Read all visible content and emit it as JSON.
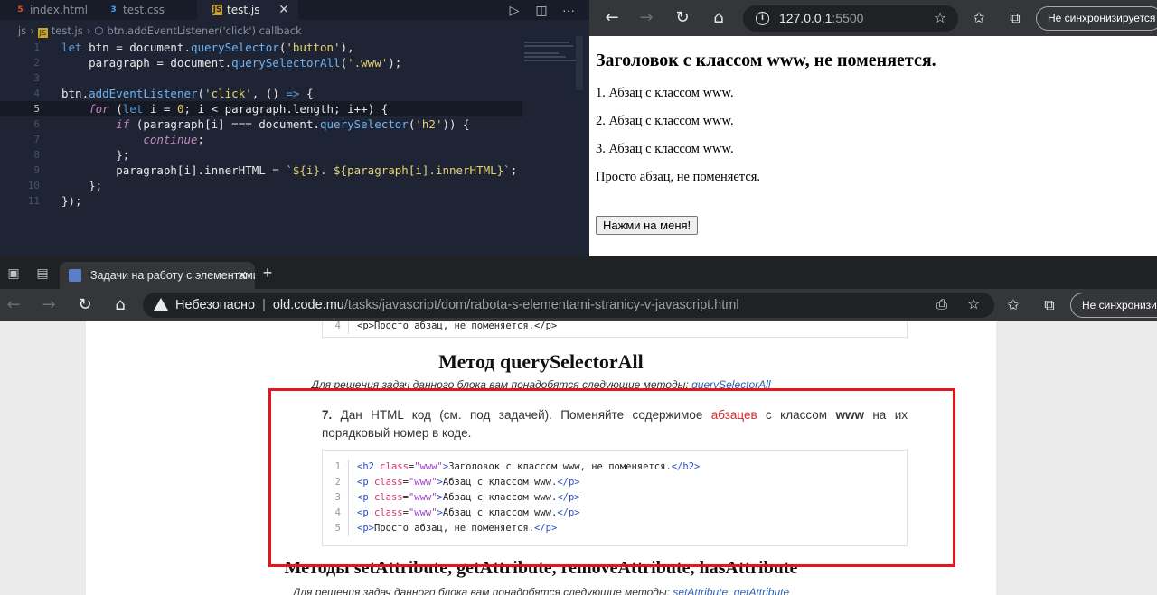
{
  "vscode": {
    "tabs": [
      {
        "name": "index.html",
        "icon": "html-file-icon",
        "color": "#e44d26"
      },
      {
        "name": "test.css",
        "icon": "css-file-icon",
        "color": "#42a5f5"
      },
      {
        "name": "test.js",
        "icon": "js-file-icon",
        "color": "#c9a227",
        "active": true
      }
    ],
    "breadcrumb": [
      "js",
      "test.js",
      "btn.addEventListener('click') callback"
    ],
    "line_numbers": [
      "1",
      "2",
      "3",
      "4",
      "5",
      "6",
      "7",
      "8",
      "9",
      "10",
      "11"
    ],
    "current_line": 5
  },
  "browser1": {
    "url_host": "127.0.0.1",
    "url_port": ":5500",
    "sync_label": "Не синхронизируется",
    "heading": "Заголовок с классом www, не поменяется.",
    "paragraphs": [
      "1. Абзац с классом www.",
      "2. Абзац с классом www.",
      "3. Абзац с классом www.",
      "Просто абзац, не поменяется."
    ],
    "button_label": "Нажми на меня!"
  },
  "browser2": {
    "tab_title": "Задачи на работу с элементами",
    "insecure_label": "Небезопасно",
    "url_host": "old.code.mu",
    "url_path": "/tasks/javascript/dom/rabota-s-elementami-stranicy-v-javascript.html",
    "sync_label": "Не синхронизи",
    "page": {
      "top_code_line_num": "4",
      "top_code_line": "<p>Просто абзац, не поменяется.</p>",
      "section1_title": "Метод querySelectorAll",
      "section1_sub": "Для решения задач данного блока вам понадобятся следующие методы: ",
      "section1_link": "querySelectorAll",
      "task_number": "7.",
      "task_text_1": " Дан HTML код (см. под задачей). Поменяйте содержимое ",
      "task_text_red": "абзацев",
      "task_text_2": " с классом ",
      "task_text_bold": "www",
      "task_text_3": " на их порядковый номер в коде.",
      "code_lines": [
        {
          "n": "1",
          "tag": "h2",
          "cls": "www",
          "text": "Заголовок с классом www, не поменяется."
        },
        {
          "n": "2",
          "tag": "p",
          "cls": "www",
          "text": "Абзац с классом www."
        },
        {
          "n": "3",
          "tag": "p",
          "cls": "www",
          "text": "Абзац с классом www."
        },
        {
          "n": "4",
          "tag": "p",
          "cls": "www",
          "text": "Абзац с классом www."
        },
        {
          "n": "5",
          "tag": "p",
          "cls": "",
          "text": "Просто абзац, не поменяется."
        }
      ],
      "section2_title": "Методы setAttribute, getAttribute, removeAttribute, hasAttribute",
      "section2_sub": "Для решения задач данного блока вам понадобятся следующие методы: ",
      "section2_link": "setAttribute, getAttribute"
    }
  },
  "colors": {
    "highlight_box": "#e3171b",
    "vscode_bg": "#1e2433",
    "browser_chrome": "#35363a"
  }
}
